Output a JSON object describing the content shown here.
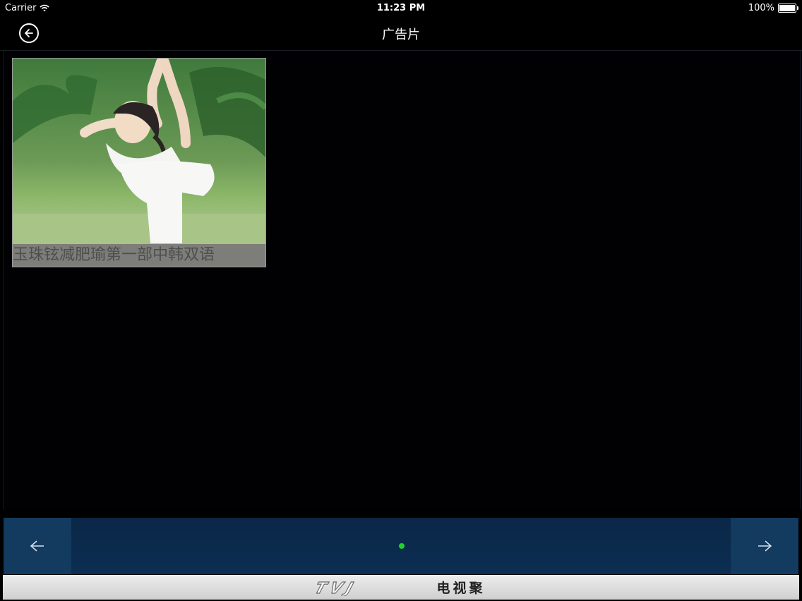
{
  "status_bar": {
    "carrier": "Carrier",
    "time": "11:23 PM",
    "battery": "100%"
  },
  "nav": {
    "title": "广告片"
  },
  "videos": [
    {
      "caption": "玉珠铉减肥瑜第一部中韩双语"
    }
  ],
  "pager": {
    "page_count": 1,
    "current_page": 1
  },
  "footer": {
    "logo_text": "TVJ",
    "app_name": "电视聚"
  },
  "colors": {
    "accent_green": "#22d22a",
    "pager_bg": "#0b2e52"
  }
}
